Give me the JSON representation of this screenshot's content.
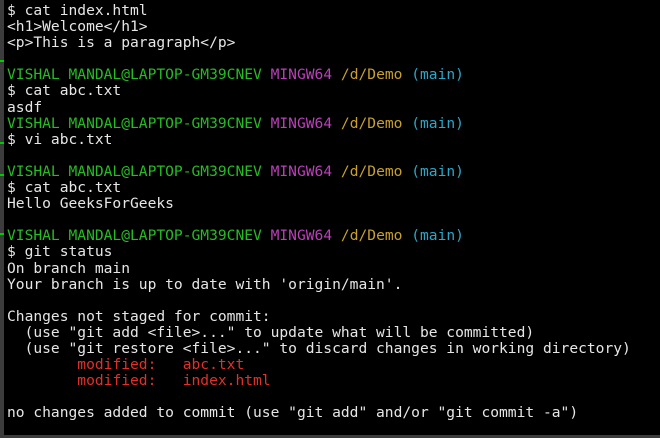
{
  "terminal": {
    "lines": [
      {
        "kind": "cmd",
        "text": "$ cat index.html"
      },
      {
        "kind": "out",
        "text": "<h1>Welcome</h1>"
      },
      {
        "kind": "out",
        "text": "<p>This is a paragraph</p>"
      },
      {
        "kind": "blank",
        "text": ""
      },
      {
        "kind": "prompt",
        "user": "VISHAL MANDAL@LAPTOP-GM39CNEV",
        "sys": "MINGW64",
        "path": "/d/Demo",
        "branch": "(main)"
      },
      {
        "kind": "cmd",
        "text": "$ cat abc.txt"
      },
      {
        "kind": "out",
        "text": "asdf"
      },
      {
        "kind": "prompt",
        "user": "VISHAL MANDAL@LAPTOP-GM39CNEV",
        "sys": "MINGW64",
        "path": "/d/Demo",
        "branch": "(main)"
      },
      {
        "kind": "cmd",
        "text": "$ vi abc.txt"
      },
      {
        "kind": "blank",
        "text": ""
      },
      {
        "kind": "prompt",
        "user": "VISHAL MANDAL@LAPTOP-GM39CNEV",
        "sys": "MINGW64",
        "path": "/d/Demo",
        "branch": "(main)"
      },
      {
        "kind": "cmd",
        "text": "$ cat abc.txt"
      },
      {
        "kind": "out",
        "text": "Hello GeeksForGeeks"
      },
      {
        "kind": "blank",
        "text": ""
      },
      {
        "kind": "prompt",
        "user": "VISHAL MANDAL@LAPTOP-GM39CNEV",
        "sys": "MINGW64",
        "path": "/d/Demo",
        "branch": "(main)"
      },
      {
        "kind": "cmd",
        "text": "$ git status"
      },
      {
        "kind": "out",
        "text": "On branch main"
      },
      {
        "kind": "out",
        "text": "Your branch is up to date with 'origin/main'."
      },
      {
        "kind": "blank",
        "text": ""
      },
      {
        "kind": "out",
        "text": "Changes not staged for commit:"
      },
      {
        "kind": "out",
        "text": "  (use \"git add <file>...\" to update what will be committed)"
      },
      {
        "kind": "out",
        "text": "  (use \"git restore <file>...\" to discard changes in working directory)"
      },
      {
        "kind": "mod",
        "label": "modified:",
        "file": "abc.txt"
      },
      {
        "kind": "mod",
        "label": "modified:",
        "file": "index.html"
      },
      {
        "kind": "blank",
        "text": ""
      },
      {
        "kind": "out",
        "text": "no changes added to commit (use \"git add\" and/or \"git commit -a\")"
      }
    ]
  },
  "colors": {
    "background": "#000000",
    "text": "#e6e6e6",
    "user_host": "#25bc24",
    "system": "#bc3fbc",
    "path": "#c8a02b",
    "branch": "#2aa7c8",
    "modified": "#e0302b"
  }
}
